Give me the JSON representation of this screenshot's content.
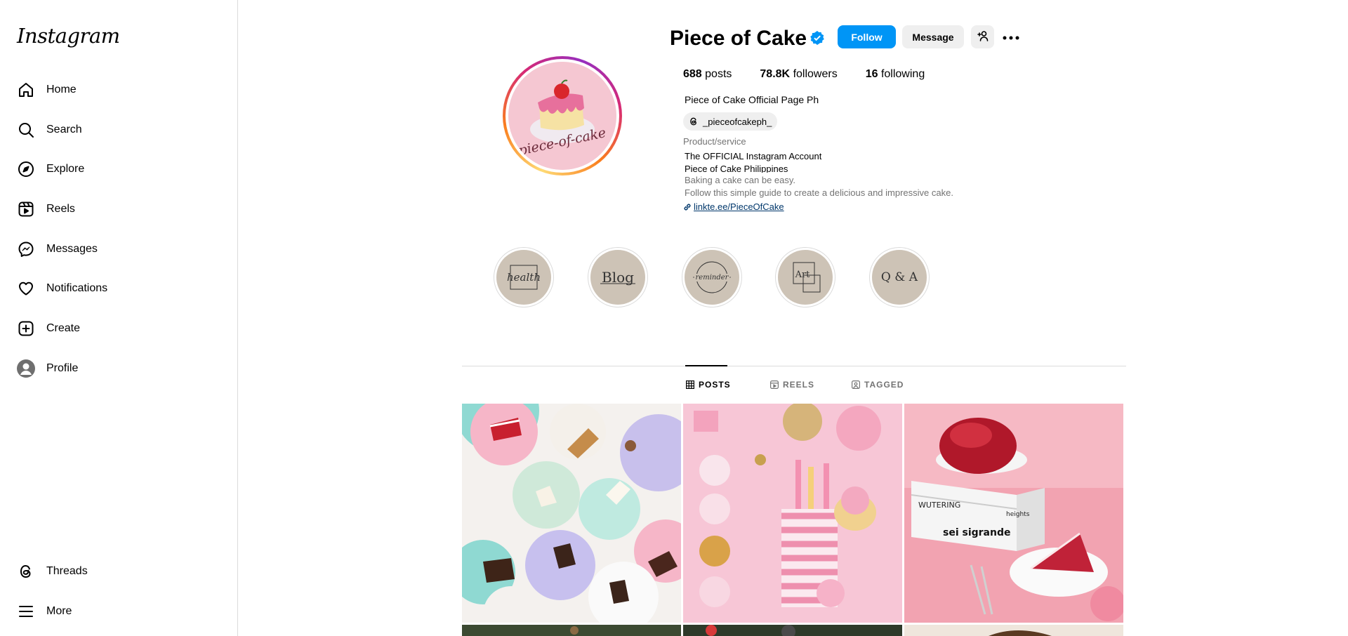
{
  "app": {
    "logo_text": "Instagram"
  },
  "sidebar": {
    "items": [
      {
        "label": "Home",
        "icon": "home-icon"
      },
      {
        "label": "Search",
        "icon": "search-icon"
      },
      {
        "label": "Explore",
        "icon": "compass-icon"
      },
      {
        "label": "Reels",
        "icon": "reels-icon"
      },
      {
        "label": "Messages",
        "icon": "messenger-icon"
      },
      {
        "label": "Notifications",
        "icon": "heart-icon"
      },
      {
        "label": "Create",
        "icon": "plus-square-icon"
      },
      {
        "label": "Profile",
        "icon": "avatar-icon"
      }
    ],
    "bottom": [
      {
        "label": "Threads",
        "icon": "threads-icon"
      },
      {
        "label": "More",
        "icon": "menu-icon"
      }
    ]
  },
  "profile": {
    "username": "Piece of Cake",
    "verified": true,
    "buttons": {
      "follow": "Follow",
      "message": "Message"
    },
    "stats": {
      "posts_count": "688",
      "posts_label": "posts",
      "followers_count": "78.8K",
      "followers_label": "followers",
      "following_count": "16",
      "following_label": "following"
    },
    "full_name": "Piece of Cake Official Page Ph",
    "threads_handle": "_pieceofcakeph_",
    "category": "Product/service",
    "bio": [
      "The OFFICIAL Instagram Account",
      "Piece of Cake Philippines",
      "Baking a cake can be easy.",
      "Follow this simple guide to create a delicious and impressive cake."
    ],
    "link": "linkte.ee/PieceOfCake",
    "avatar_text": "piece-of-cake"
  },
  "highlights": [
    {
      "text": "health"
    },
    {
      "text": "Blog"
    },
    {
      "text": "reminder"
    },
    {
      "text": "Art"
    },
    {
      "text": "Q & A"
    }
  ],
  "tabs": [
    {
      "label": "POSTS",
      "active": true
    },
    {
      "label": "REELS",
      "active": false
    },
    {
      "label": "TAGGED",
      "active": false
    }
  ],
  "posts": [
    {
      "caption_words": []
    },
    {
      "caption_words": []
    },
    {
      "caption_words": [
        "WUTERING",
        "heights",
        "sei sigrande"
      ]
    }
  ],
  "colors": {
    "accent": "#0095f6",
    "link": "#00376b",
    "muted": "#737373",
    "border": "#dbdbdb"
  }
}
